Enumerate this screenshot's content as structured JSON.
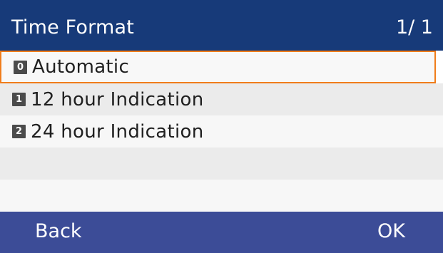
{
  "header": {
    "title": "Time Format",
    "page": "1/ 1"
  },
  "list": {
    "items": [
      {
        "index": "0",
        "label": "Automatic",
        "selected": true
      },
      {
        "index": "1",
        "label": "12 hour Indication",
        "selected": false
      },
      {
        "index": "2",
        "label": "24 hour Indication",
        "selected": false
      }
    ]
  },
  "footer": {
    "left_softkey": "Back",
    "right_softkey": "OK"
  },
  "colors": {
    "header_bg": "#173a79",
    "footer_bg": "#3c4c97",
    "selection_border": "#f07d1b",
    "row_light": "#f7f7f7",
    "row_gray": "#ebebeb",
    "icon_bg": "#4b4b4b"
  }
}
